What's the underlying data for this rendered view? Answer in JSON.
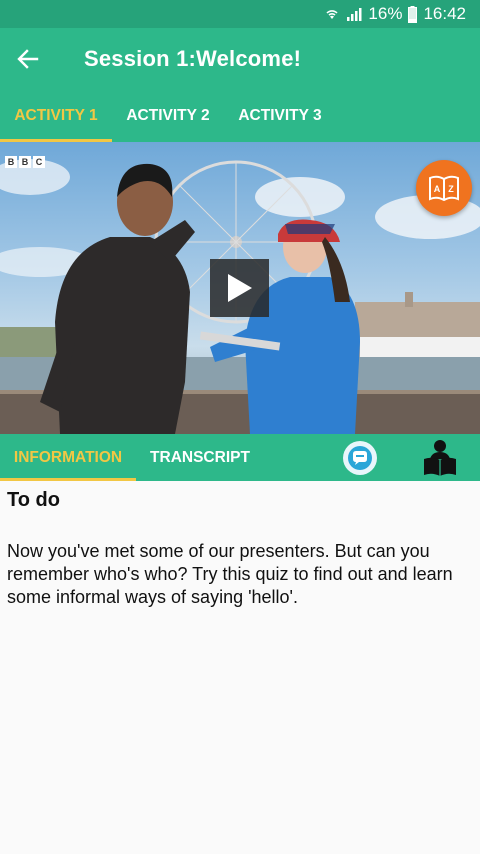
{
  "status_bar": {
    "battery": "16%",
    "time": "16:42"
  },
  "header": {
    "title": "Session 1:Welcome!"
  },
  "activity_tabs": [
    {
      "label": "ACTIVITY 1",
      "active": true
    },
    {
      "label": "ACTIVITY 2",
      "active": false
    },
    {
      "label": "ACTIVITY 3",
      "active": false
    }
  ],
  "video": {
    "broadcaster_logo": [
      "B",
      "B",
      "C"
    ],
    "play_icon": "play-icon",
    "glossary_icon": "a-z-book-icon"
  },
  "info_tabs": [
    {
      "label": "INFORMATION",
      "active": true
    },
    {
      "label": "TRANSCRIPT",
      "active": false
    }
  ],
  "info_actions": {
    "quiz_icon": "quiz-icon",
    "reader_icon": "reader-icon"
  },
  "content": {
    "heading": "To do",
    "body": "Now you've met some of our presenters. But can you remember who's who? Try this quiz to find out and learn some informal ways of saying 'hello'."
  },
  "colors": {
    "status_bar": "#26a37a",
    "primary": "#2db88a",
    "accent": "#f2c744",
    "glossary": "#f0731f"
  }
}
